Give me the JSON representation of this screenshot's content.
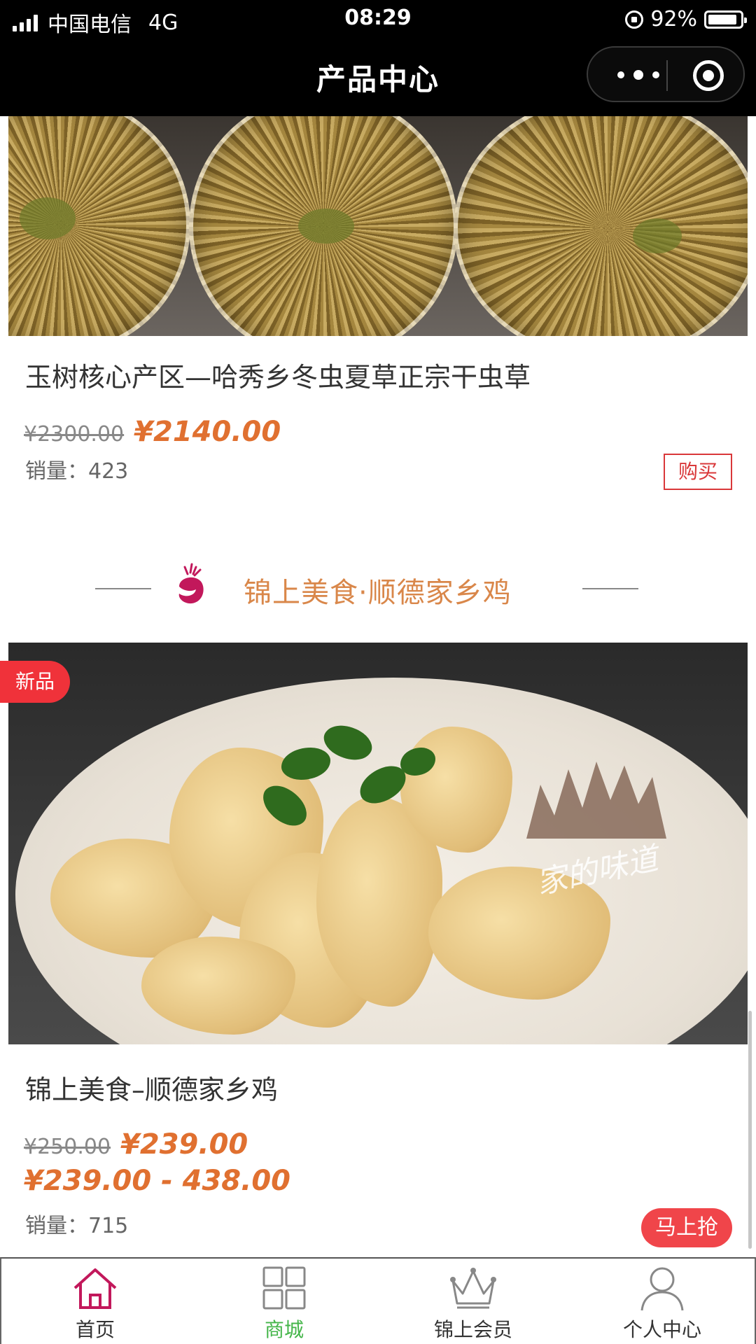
{
  "status_bar": {
    "carrier": "中国电信",
    "network": "4G",
    "time": "08:29",
    "battery": "92%",
    "battery_level": 0.92
  },
  "nav": {
    "title": "产品中心"
  },
  "products": [
    {
      "title": "玉树核心产区—哈秀乡冬虫夏草正宗干虫草",
      "old_price": "¥2300.00",
      "price": "¥2140.00",
      "sales_label": "销量：",
      "sales_count": "423",
      "button": "购买"
    },
    {
      "badge": "新品",
      "title": "锦上美食–顺德家乡鸡",
      "old_price": "¥250.00",
      "price": "¥239.00",
      "price_range": "¥239.00 - 438.00",
      "sales_label": "销量：",
      "sales_count": "715",
      "button": "马上抢",
      "image_caption": "家的味道"
    }
  ],
  "section": {
    "title": "锦上美食·顺德家乡鸡",
    "icon": "deer-logo-icon"
  },
  "tabs": [
    {
      "label": "首页",
      "icon": "home-icon",
      "active": false
    },
    {
      "label": "商城",
      "icon": "grid-icon",
      "active": true
    },
    {
      "label": "锦上会员",
      "icon": "crown-icon",
      "active": false
    },
    {
      "label": "个人中心",
      "icon": "user-icon",
      "active": false
    }
  ],
  "colors": {
    "accent_orange": "#e07030",
    "brand_red": "#f0454a",
    "tab_active": "#44b549"
  }
}
